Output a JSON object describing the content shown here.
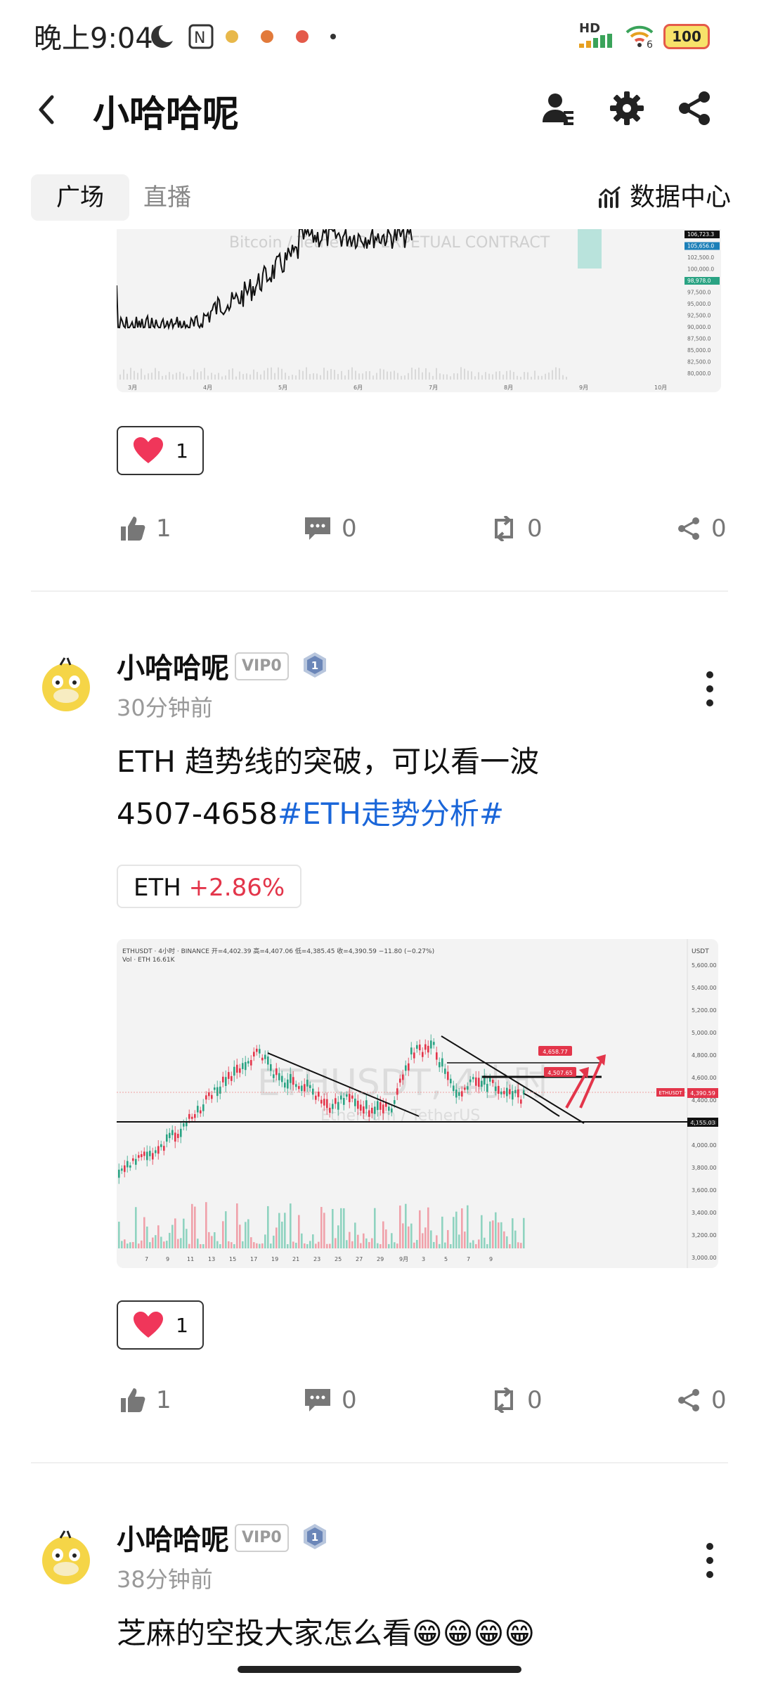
{
  "status": {
    "time": "晚上9:04",
    "network": "HD",
    "signal": "6",
    "battery": "100"
  },
  "header": {
    "back_label": "back",
    "title": "小哈哈呢"
  },
  "tabs": {
    "active": "广场",
    "second": "直播",
    "data_center": "数据中心"
  },
  "chart1": {
    "watermark": "Bitcoin / TetherUS PERPETUAL CONTRACT",
    "x_labels": [
      "3月",
      "4月",
      "5月",
      "6月",
      "7月",
      "8月",
      "9月",
      "10月"
    ],
    "y_labels": [
      "106,723.3",
      "105,656.0",
      "102,500.0",
      "100,000.0",
      "98,978.0",
      "97,500.0",
      "95,000.0",
      "92,500.0",
      "90,000.0",
      "87,500.0",
      "85,000.0",
      "82,500.0",
      "80,000.0"
    ]
  },
  "post0": {
    "like_count": "1",
    "thumbs": "1",
    "comments": "0",
    "reposts": "0",
    "shares": "0"
  },
  "post1": {
    "author": "小哈哈呢",
    "vip": "VIP0",
    "level": "1",
    "time": "30分钟前",
    "text_line1": "ETH  趋势线的突破，可以看一波",
    "text_line2_plain": "4507-4658",
    "hashtag": "#ETH走势分析#",
    "token": {
      "symbol": "ETH",
      "change": "+2.86%"
    },
    "like_count": "1",
    "thumbs": "1",
    "comments": "0",
    "reposts": "0",
    "shares": "0"
  },
  "chart2": {
    "header_text": "ETHUSDT · 4小时 · BINANCE  开=4,402.39  高=4,407.06  低=4,385.45  收=4,390.59  −11.80 (−0.27%)",
    "vol_text": "Vol · ETH  16.61K",
    "currency": "USDT",
    "watermark": "ETHUSDT, 4小时",
    "watermark2": "Ethereum / TetherUS",
    "label_target": "4,658.77",
    "label_mid": "4,507.65",
    "label_price": "4,390.59",
    "label_symbol": "ETHUSDT",
    "label_support": "4,155.03",
    "x_labels": [
      "7",
      "9",
      "11",
      "13",
      "15",
      "17",
      "19",
      "21",
      "23",
      "25",
      "27",
      "29",
      "9月",
      "3",
      "5",
      "7",
      "9"
    ],
    "y_labels": [
      "5,600.00",
      "5,400.00",
      "5,200.00",
      "5,000.00",
      "4,800.00",
      "4,600.00",
      "4,400.00",
      "4,200.00",
      "4,000.00",
      "3,800.00",
      "3,600.00",
      "3,400.00",
      "3,200.00",
      "3,000.00"
    ]
  },
  "post2": {
    "author": "小哈哈呢",
    "vip": "VIP0",
    "level": "1",
    "time": "38分钟前",
    "text": "芝麻的空投大家怎么看😁😁😁😁"
  },
  "colors": {
    "accent_blue": "#1a66d9",
    "up_red": "#e3354a",
    "heart": "#f0365a"
  }
}
